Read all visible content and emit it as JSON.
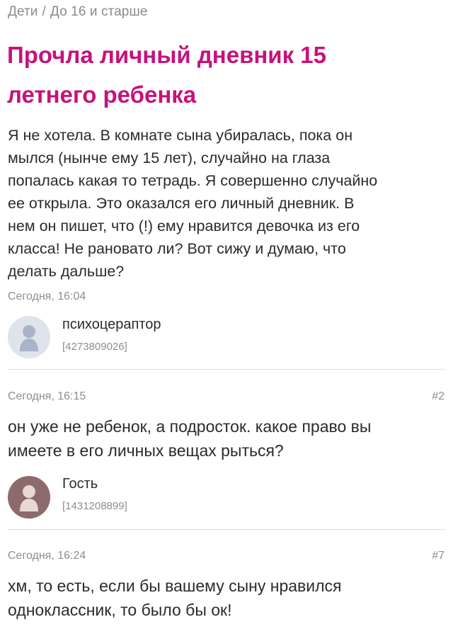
{
  "breadcrumb": {
    "category": "Дети",
    "separator": "/",
    "subcategory": "До 16 и старше"
  },
  "post": {
    "title_line1": "Прочла личный дневник 15",
    "title_line2": "летнего ребенка",
    "body_lines": [
      "Я не хотела. В комнате сына убиралась, пока он",
      "мылся (нынче ему 15 лет), случайно на глаза",
      "попалась какая то тетрадь. Я совершенно случайно",
      "ее открыла. Это оказался его личный дневник. В",
      "нем он пишет, что (!) ему нравится девочка из его",
      "класса! Не рановато ли? Вот сижу и думаю, что",
      "делать дальше?"
    ],
    "date": "Сегодня, 16:04",
    "author": {
      "name": "психоцераптор",
      "id": "[4273809026]",
      "avatar_icon": "user-silhouette-icon",
      "avatar_bg": "#dfe3ec"
    }
  },
  "comments": [
    {
      "date": "Сегодня, 16:15",
      "number": "#2",
      "text_lines": [
        "он уже не ребенок, а подросток. какое право вы",
        "имеете в его личных вещах рыться?"
      ],
      "author": {
        "name": "Гость",
        "id": "[1431208899]",
        "avatar_icon": "user-silhouette-icon",
        "avatar_bg": "#8e6b6b"
      }
    },
    {
      "date": "Сегодня, 16:24",
      "number": "#7",
      "text_lines": [
        "хм, то есть, если бы вашему сыну нравился",
        "одноклассник, то было бы ок!"
      ]
    }
  ],
  "colors": {
    "accent": "#c7127b",
    "meta_text": "#8e8e8e",
    "divider": "#dedede"
  }
}
